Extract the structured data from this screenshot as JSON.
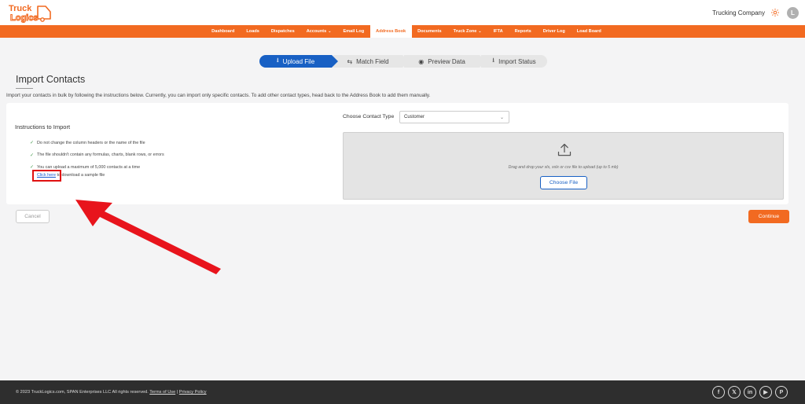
{
  "header": {
    "logo_line1": "Truck",
    "logo_line2": "Logics",
    "company": "Trucking Company",
    "avatar_initial": "L"
  },
  "nav": {
    "items": [
      {
        "label": "Dashboard"
      },
      {
        "label": "Loads"
      },
      {
        "label": "Dispatches"
      },
      {
        "label": "Accounts",
        "caret": "⌄"
      },
      {
        "label": "Email Log"
      },
      {
        "label": "Address Book",
        "active": true
      },
      {
        "label": "Documents"
      },
      {
        "label": "Truck Zone",
        "caret": "⌄"
      },
      {
        "label": "IFTA"
      },
      {
        "label": "Reports"
      },
      {
        "label": "Driver Log"
      },
      {
        "label": "Load Board"
      }
    ]
  },
  "stepper": {
    "steps": [
      {
        "icon": "⭳",
        "label": "Upload File"
      },
      {
        "icon": "⇆",
        "label": "Match Field"
      },
      {
        "icon": "◉",
        "label": "Preview Data"
      },
      {
        "icon": "⭳",
        "label": "Import Status"
      }
    ]
  },
  "page": {
    "title": "Import Contacts",
    "description": "Import your contacts in bulk by following the instructions below. Currently, you can import only specific contacts. To add other contact types, head back to the Address Book to add them manually."
  },
  "instructions": {
    "title": "Instructions to Import",
    "items": [
      "Do not change the column headers or the name of the file",
      "The file shouldn't contain any formulas, charts, blank rows, or errors",
      "You can upload a maximum of 5,000 contacts at a time"
    ],
    "sample_link": "Click here",
    "sample_rest": " to download a sample file"
  },
  "contact_type": {
    "label": "Choose Contact Type",
    "selected": "Customer"
  },
  "dropzone": {
    "text": "Drag and drop your xls, xslx or csv file to upload (up to 5 mb)",
    "button": "Choose File"
  },
  "actions": {
    "cancel": "Cancel",
    "continue": "Continue"
  },
  "footer": {
    "copyright": "© 2023 TruckLogics.com, SPAN Enterprises LLC All rights reserved. ",
    "terms": "Terms of Use",
    "separator": " | ",
    "privacy": "Privacy Policy",
    "socials": [
      "facebook-icon",
      "x-icon",
      "linkedin-icon",
      "youtube-icon",
      "pinterest-icon"
    ]
  },
  "colors": {
    "brand_orange": "#f26a21",
    "step_active": "#1860c4",
    "annotation_red": "#e01010",
    "footer_bg": "#2e2e2e"
  }
}
